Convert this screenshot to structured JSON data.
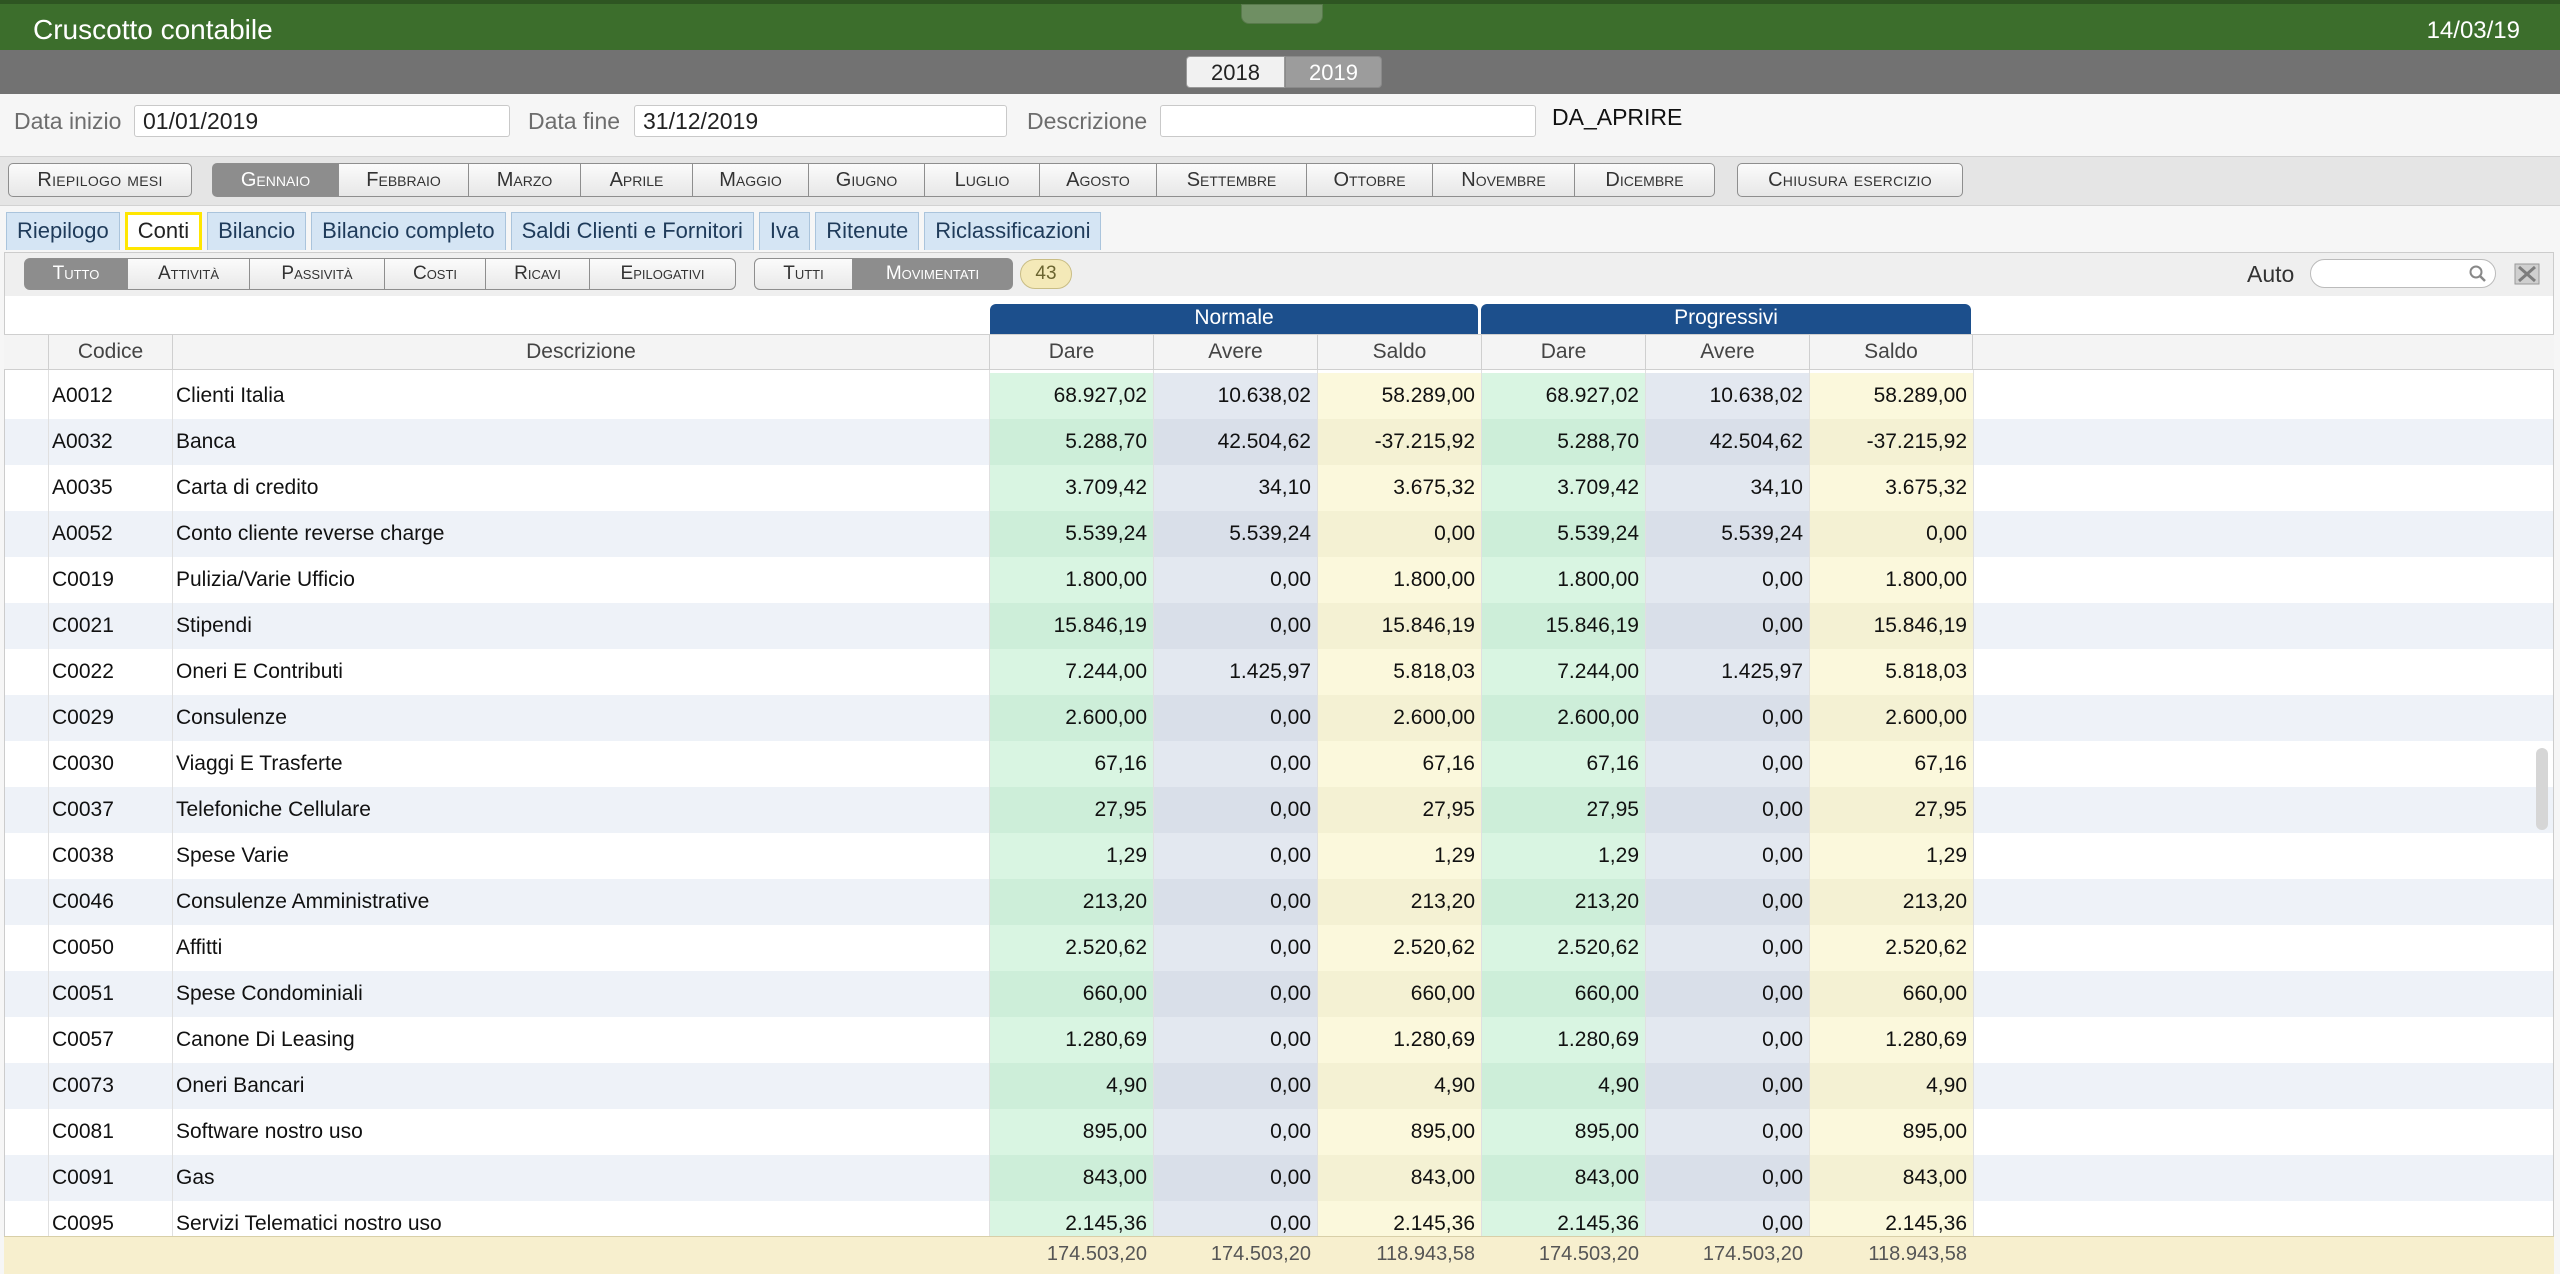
{
  "header": {
    "title": "Cruscotto contabile",
    "date": "14/03/19"
  },
  "years": [
    "2018",
    "2019"
  ],
  "filters": {
    "start_label": "Data inizio",
    "start_value": "01/01/2019",
    "end_label": "Data fine",
    "end_value": "31/12/2019",
    "desc_label": "Descrizione",
    "desc_value": "",
    "status": "DA_APRIRE"
  },
  "months_row": {
    "summary": "Riepilogo mesi",
    "months": [
      "Gennaio",
      "Febbraio",
      "Marzo",
      "Aprile",
      "Maggio",
      "Giugno",
      "Luglio",
      "Agosto",
      "Settembre",
      "Ottobre",
      "Novembre",
      "Dicembre"
    ],
    "active_month": "Gennaio",
    "closing": "Chiusura esercizio"
  },
  "tabs": [
    "Riepilogo",
    "Conti",
    "Bilancio",
    "Bilancio completo",
    "Saldi Clienti e Fornitori",
    "Iva",
    "Ritenute",
    "Riclassificazioni"
  ],
  "selected_tab": "Conti",
  "type_filter": [
    "Tutto",
    "Attività",
    "Passività",
    "Costi",
    "Ricavi",
    "Epilogativi"
  ],
  "movement_filter": [
    "Tutti",
    "Movimentati"
  ],
  "count": "43",
  "auto_label": "Auto",
  "table": {
    "groups": {
      "normale": "Normale",
      "progressivi": "Progressivi"
    },
    "headers": {
      "codice": "Codice",
      "descrizione": "Descrizione",
      "dare": "Dare",
      "avere": "Avere",
      "saldo": "Saldo"
    },
    "rows": [
      [
        "A0012",
        "Clienti Italia",
        "68.927,02",
        "10.638,02",
        "58.289,00",
        "68.927,02",
        "10.638,02",
        "58.289,00"
      ],
      [
        "A0032",
        "Banca",
        "5.288,70",
        "42.504,62",
        "-37.215,92",
        "5.288,70",
        "42.504,62",
        "-37.215,92"
      ],
      [
        "A0035",
        "Carta di credito",
        "3.709,42",
        "34,10",
        "3.675,32",
        "3.709,42",
        "34,10",
        "3.675,32"
      ],
      [
        "A0052",
        "Conto cliente reverse charge",
        "5.539,24",
        "5.539,24",
        "0,00",
        "5.539,24",
        "5.539,24",
        "0,00"
      ],
      [
        "C0019",
        "Pulizia/Varie Ufficio",
        "1.800,00",
        "0,00",
        "1.800,00",
        "1.800,00",
        "0,00",
        "1.800,00"
      ],
      [
        "C0021",
        "Stipendi",
        "15.846,19",
        "0,00",
        "15.846,19",
        "15.846,19",
        "0,00",
        "15.846,19"
      ],
      [
        "C0022",
        "Oneri E Contributi",
        "7.244,00",
        "1.425,97",
        "5.818,03",
        "7.244,00",
        "1.425,97",
        "5.818,03"
      ],
      [
        "C0029",
        "Consulenze",
        "2.600,00",
        "0,00",
        "2.600,00",
        "2.600,00",
        "0,00",
        "2.600,00"
      ],
      [
        "C0030",
        "Viaggi E Trasferte",
        "67,16",
        "0,00",
        "67,16",
        "67,16",
        "0,00",
        "67,16"
      ],
      [
        "C0037",
        "Telefoniche Cellulare",
        "27,95",
        "0,00",
        "27,95",
        "27,95",
        "0,00",
        "27,95"
      ],
      [
        "C0038",
        "Spese Varie",
        "1,29",
        "0,00",
        "1,29",
        "1,29",
        "0,00",
        "1,29"
      ],
      [
        "C0046",
        "Consulenze Amministrative",
        "213,20",
        "0,00",
        "213,20",
        "213,20",
        "0,00",
        "213,20"
      ],
      [
        "C0050",
        "Affitti",
        "2.520,62",
        "0,00",
        "2.520,62",
        "2.520,62",
        "0,00",
        "2.520,62"
      ],
      [
        "C0051",
        "Spese Condominiali",
        "660,00",
        "0,00",
        "660,00",
        "660,00",
        "0,00",
        "660,00"
      ],
      [
        "C0057",
        "Canone Di Leasing",
        "1.280,69",
        "0,00",
        "1.280,69",
        "1.280,69",
        "0,00",
        "1.280,69"
      ],
      [
        "C0073",
        "Oneri Bancari",
        "4,90",
        "0,00",
        "4,90",
        "4,90",
        "0,00",
        "4,90"
      ],
      [
        "C0081",
        "Software nostro uso",
        "895,00",
        "0,00",
        "895,00",
        "895,00",
        "0,00",
        "895,00"
      ],
      [
        "C0091",
        "Gas",
        "843,00",
        "0,00",
        "843,00",
        "843,00",
        "0,00",
        "843,00"
      ],
      [
        "C0095",
        "Servizi Telematici nostro uso",
        "2.145,36",
        "0,00",
        "2.145,36",
        "2.145,36",
        "0,00",
        "2.145,36"
      ]
    ],
    "totals": [
      "174.503,20",
      "174.503,20",
      "118.943,58",
      "174.503,20",
      "174.503,20",
      "118.943,58"
    ]
  }
}
